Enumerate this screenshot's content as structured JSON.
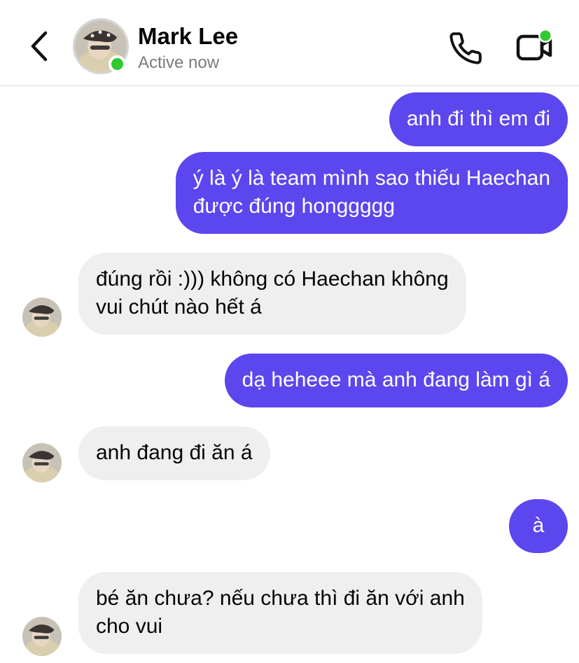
{
  "header": {
    "contact_name": "Mark Lee",
    "status": "Active now",
    "back_icon": "chevron-left-icon",
    "call_icon": "phone-icon",
    "video_icon": "video-camera-icon",
    "online_color": "#31c930"
  },
  "colors": {
    "sent_bubble": "#5c46ee",
    "received_bubble": "#efefef"
  },
  "messages": [
    {
      "sender": "me",
      "lines": [
        "anh đi thì em đi"
      ]
    },
    {
      "sender": "me",
      "lines": [
        "ý là ý là team mình sao thiếu Haechan",
        "được đúng honggggg"
      ]
    },
    {
      "sender": "Mark Lee",
      "lines": [
        "đúng rồi :))) không có Haechan không",
        "vui chút nào hết á"
      ]
    },
    {
      "sender": "me",
      "lines": [
        "dạ heheee mà anh đang làm gì á"
      ]
    },
    {
      "sender": "Mark Lee",
      "lines": [
        "anh đang đi ăn á"
      ]
    },
    {
      "sender": "me",
      "lines": [
        "à"
      ]
    },
    {
      "sender": "Mark Lee",
      "lines": [
        "bé ăn chưa? nếu chưa thì đi ăn với anh",
        "cho vui"
      ]
    }
  ]
}
